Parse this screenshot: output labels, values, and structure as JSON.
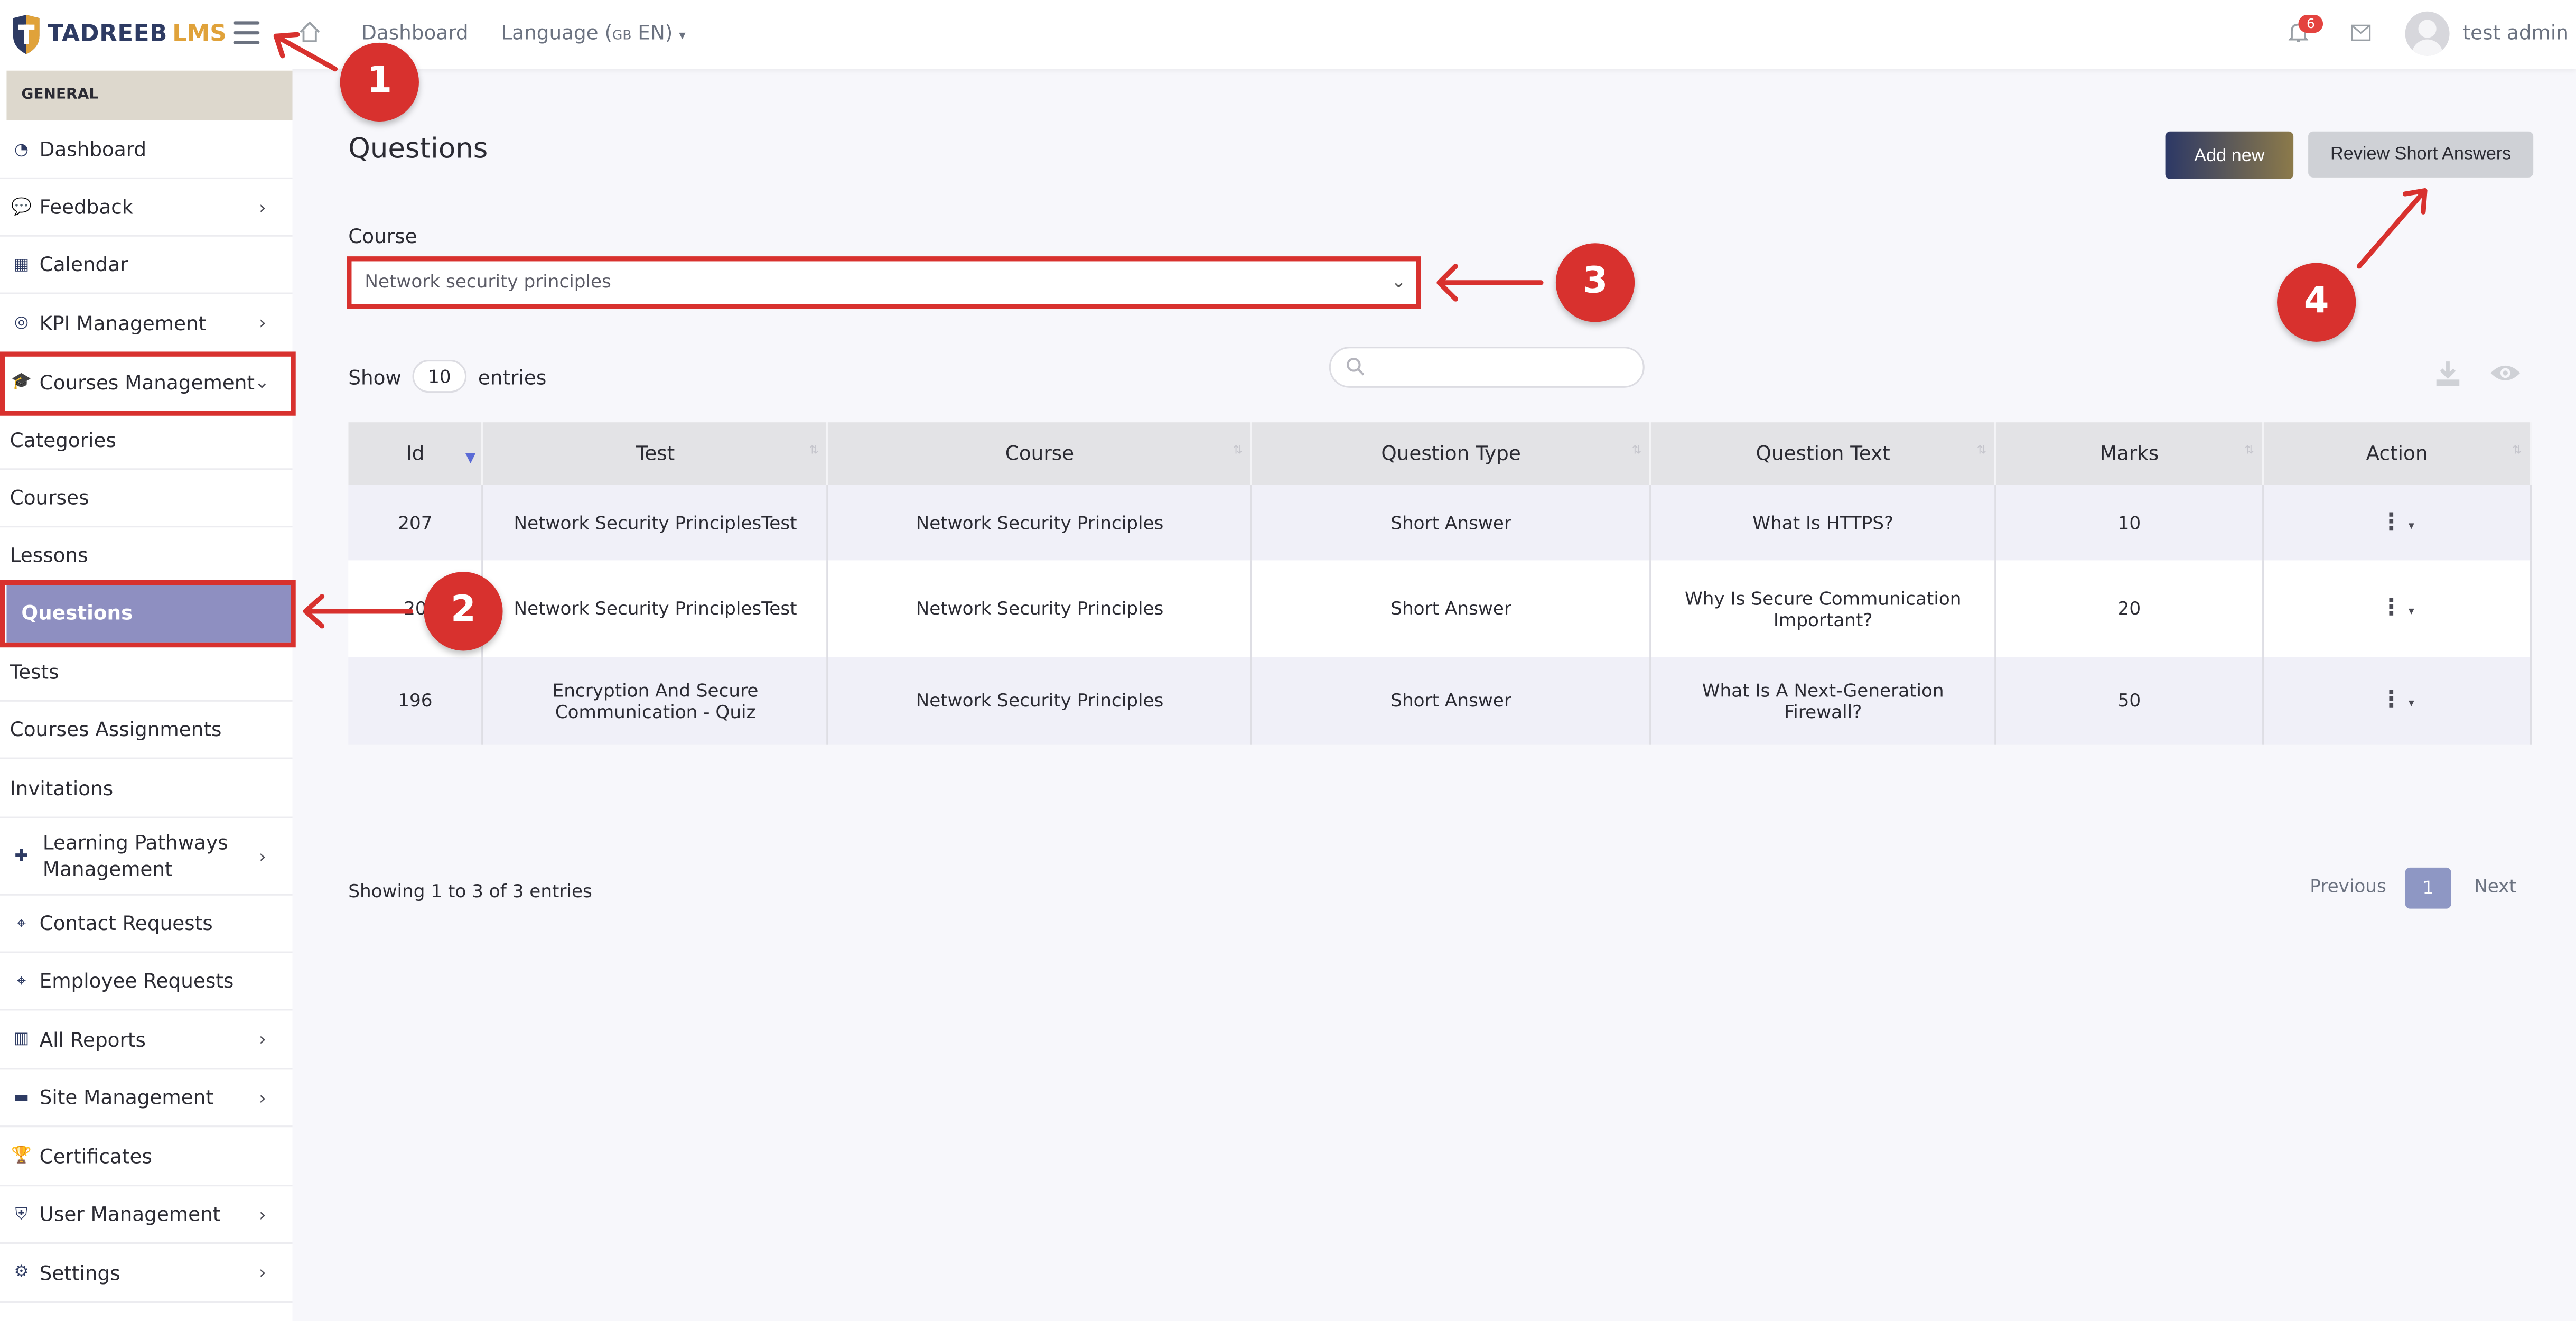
{
  "brand": {
    "name_part1": "TADREEB",
    "name_part2": "LMS"
  },
  "topbar": {
    "dashboard_link": "Dashboard",
    "language_label": "Language (",
    "language_flag": "GB",
    "language_code": " EN)",
    "notification_count": "6",
    "username": "test admin"
  },
  "sidebar": {
    "section_header": "GENERAL",
    "items": [
      {
        "label": "Dashboard",
        "icon": "gauge-icon"
      },
      {
        "label": "Feedback",
        "icon": "comments-icon"
      },
      {
        "label": "Calendar",
        "icon": "calendar-icon"
      },
      {
        "label": "KPI Management",
        "icon": "target-icon"
      },
      {
        "label": "Courses Management",
        "icon": "graduation-cap-icon"
      },
      {
        "label": "Categories"
      },
      {
        "label": "Courses"
      },
      {
        "label": "Lessons"
      },
      {
        "label": "Questions"
      },
      {
        "label": "Tests"
      },
      {
        "label": "Courses Assignments"
      },
      {
        "label": "Invitations"
      },
      {
        "label": "Learning Pathways Management",
        "icon": "puzzle-icon"
      },
      {
        "label": "Contact Requests",
        "icon": "tag-icon"
      },
      {
        "label": "Employee Requests",
        "icon": "tag-icon"
      },
      {
        "label": "All Reports",
        "icon": "chart-icon"
      },
      {
        "label": "Site Management",
        "icon": "folder-icon"
      },
      {
        "label": "Certificates",
        "icon": "trophy-icon"
      },
      {
        "label": "User Management",
        "icon": "shield-icon"
      },
      {
        "label": "Settings",
        "icon": "gear-icon"
      }
    ]
  },
  "main": {
    "title": "Questions",
    "add_new_label": "Add new",
    "review_label": "Review Short Answers",
    "course_label": "Course",
    "course_selected": "Network security principles",
    "show_label": "Show",
    "entries_count": "10",
    "entries_label": "entries",
    "table": {
      "columns": [
        "Id",
        "Test",
        "Course",
        "Question Type",
        "Question Text",
        "Marks",
        "Action"
      ],
      "rows": [
        {
          "id": "207",
          "test": "Network Security PrinciplesTest",
          "course": "Network Security Principles",
          "type": "Short Answer",
          "text": "What Is HTTPS?",
          "marks": "10"
        },
        {
          "id": "20",
          "test": "Network Security PrinciplesTest",
          "course": "Network Security Principles",
          "type": "Short Answer",
          "text": "Why Is Secure Communication Important?",
          "marks": "20"
        },
        {
          "id": "196",
          "test": "Encryption And Secure Communication - Quiz",
          "course": "Network Security Principles",
          "type": "Short Answer",
          "text": "What Is A Next-Generation Firewall?",
          "marks": "50"
        }
      ]
    },
    "showing_text": "Showing 1 to 3 of 3 entries",
    "pagination": {
      "previous": "Previous",
      "page": "1",
      "next": "Next"
    }
  },
  "annotations": [
    "1",
    "2",
    "3",
    "4"
  ],
  "colors": {
    "accent": "#8e8fc1",
    "annotation_red": "#d8312e",
    "brand_navy": "#2e3b63",
    "brand_gold": "#e0a23a"
  }
}
